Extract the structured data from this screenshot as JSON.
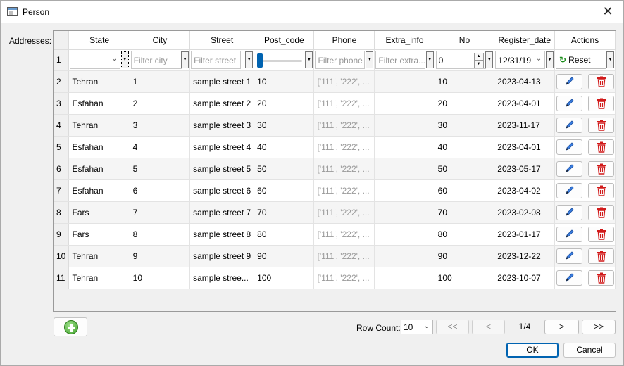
{
  "window": {
    "title": "Person",
    "close_glyph": "✕"
  },
  "addresses_label": "Addresses:",
  "table": {
    "columns": [
      "State",
      "City",
      "Street",
      "Post_code",
      "Phone",
      "Extra_info",
      "No",
      "Register_date",
      "Actions"
    ],
    "filter_row": {
      "row_header": "1",
      "city_placeholder": "Filter city",
      "street_placeholder": "Filter street",
      "phone_placeholder": "Filter phone",
      "extra_placeholder": "Filter extra...",
      "no_value": "0",
      "date_value": "12/31/19",
      "reset_label": "Reset"
    },
    "rows": [
      {
        "rh": "2",
        "state": "Tehran",
        "city": "1",
        "street": "sample street 1",
        "post": "10",
        "phone": "['111', '222', ...",
        "extra": "",
        "no": "10",
        "date": "2023-04-13"
      },
      {
        "rh": "3",
        "state": "Esfahan",
        "city": "2",
        "street": "sample street 2",
        "post": "20",
        "phone": "['111', '222', ...",
        "extra": "",
        "no": "20",
        "date": "2023-04-01"
      },
      {
        "rh": "4",
        "state": "Tehran",
        "city": "3",
        "street": "sample street 3",
        "post": "30",
        "phone": "['111', '222', ...",
        "extra": "",
        "no": "30",
        "date": "2023-11-17"
      },
      {
        "rh": "5",
        "state": "Esfahan",
        "city": "4",
        "street": "sample street 4",
        "post": "40",
        "phone": "['111', '222', ...",
        "extra": "",
        "no": "40",
        "date": "2023-04-01"
      },
      {
        "rh": "6",
        "state": "Esfahan",
        "city": "5",
        "street": "sample street 5",
        "post": "50",
        "phone": "['111', '222', ...",
        "extra": "",
        "no": "50",
        "date": "2023-05-17"
      },
      {
        "rh": "7",
        "state": "Esfahan",
        "city": "6",
        "street": "sample street 6",
        "post": "60",
        "phone": "['111', '222', ...",
        "extra": "",
        "no": "60",
        "date": "2023-04-02"
      },
      {
        "rh": "8",
        "state": "Fars",
        "city": "7",
        "street": "sample street 7",
        "post": "70",
        "phone": "['111', '222', ...",
        "extra": "",
        "no": "70",
        "date": "2023-02-08"
      },
      {
        "rh": "9",
        "state": "Fars",
        "city": "8",
        "street": "sample street 8",
        "post": "80",
        "phone": "['111', '222', ...",
        "extra": "",
        "no": "80",
        "date": "2023-01-17"
      },
      {
        "rh": "10",
        "state": "Tehran",
        "city": "9",
        "street": "sample street 9",
        "post": "90",
        "phone": "['111', '222', ...",
        "extra": "",
        "no": "90",
        "date": "2023-12-22"
      },
      {
        "rh": "11",
        "state": "Tehran",
        "city": "10",
        "street": "sample stree...",
        "post": "100",
        "phone": "['111', '222', ...",
        "extra": "",
        "no": "100",
        "date": "2023-10-07"
      }
    ],
    "icons": {
      "edit": "pencil-icon",
      "delete": "trash-icon",
      "reset": "reset-icon",
      "add": "plus-circle-icon"
    }
  },
  "footer": {
    "row_count_label": "Row Count:",
    "row_count_value": "10",
    "first_label": "<<",
    "prev_label": "<",
    "page_indicator": "1/4",
    "next_label": ">",
    "last_label": ">>",
    "ok_label": "OK",
    "cancel_label": "Cancel"
  },
  "colors": {
    "accent": "#0063b1",
    "delete_red": "#d11a1a",
    "edit_blue": "#1f5fbf",
    "add_green": "#3fa02b"
  }
}
